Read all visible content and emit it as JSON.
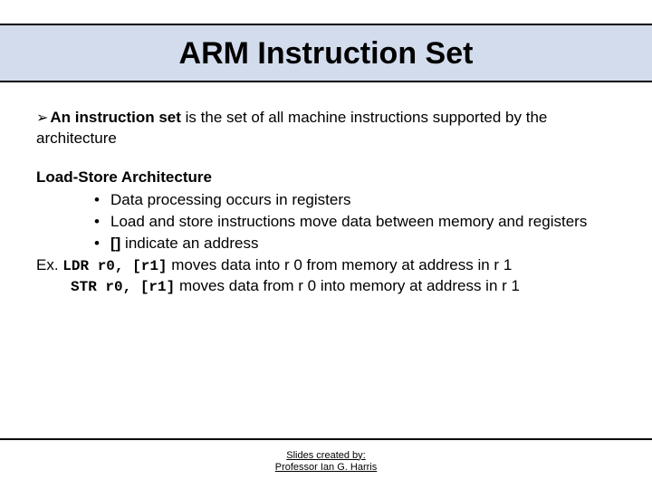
{
  "title": "ARM Instruction Set",
  "intro": {
    "arrow": "➢",
    "bold_prefix": "An instruction set",
    "rest": " is the set of all machine instructions supported by the architecture"
  },
  "section_head": "Load-Store Architecture",
  "bullets": [
    "Data processing occurs in registers",
    "Load and store instructions move data between memory and registers"
  ],
  "bullet3": {
    "bold": "[]",
    "rest": " indicate an address"
  },
  "example1": {
    "prefix": "Ex. ",
    "code": "LDR r0, [r1]",
    "after": " moves data into r 0 from memory at address in r 1"
  },
  "example2": {
    "code": "STR r0, [r1]",
    "after": " moves data from r 0 into memory at address in r 1"
  },
  "footer": {
    "line1": "Slides created by: ",
    "line2": "Professor Ian G. Harris "
  }
}
